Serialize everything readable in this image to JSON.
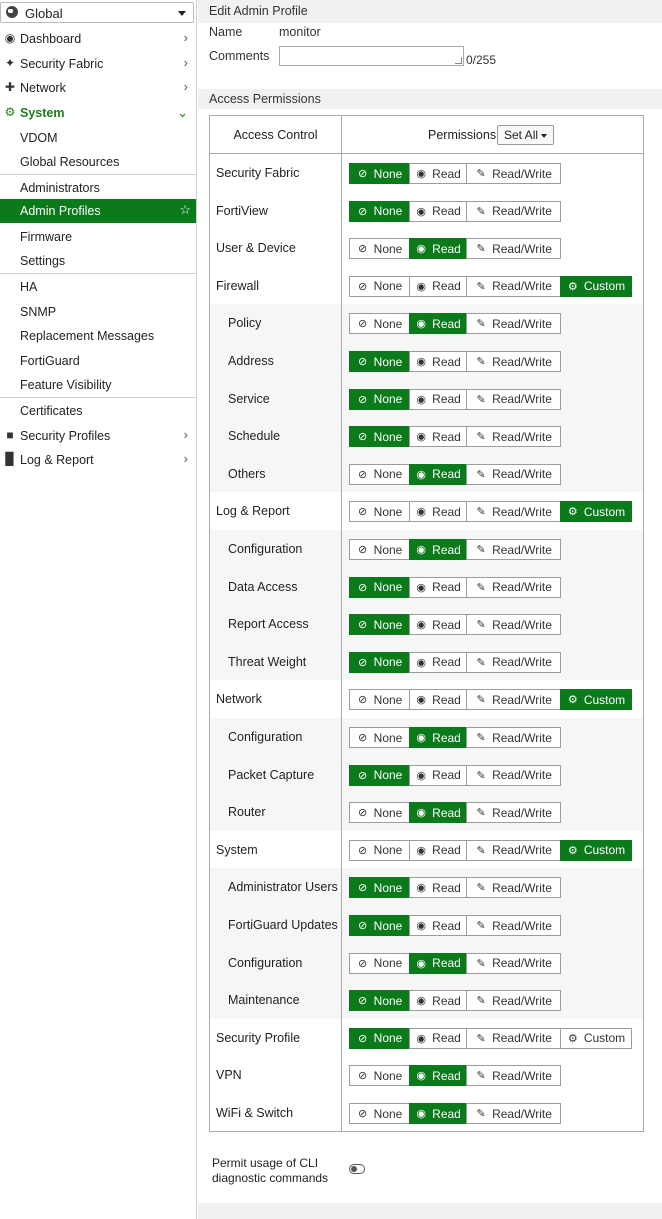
{
  "sidebar": {
    "vdom_select": "Global",
    "items": [
      {
        "label": "Dashboard",
        "icon": "dashboard-icon"
      },
      {
        "label": "Security Fabric",
        "icon": "security-fabric-icon"
      },
      {
        "label": "Network",
        "icon": "network-icon"
      },
      {
        "label": "System",
        "icon": "gear-icon"
      },
      {
        "label": "VDOM"
      },
      {
        "label": "Global Resources"
      },
      {
        "label": "Administrators"
      },
      {
        "label": "Admin Profiles"
      },
      {
        "label": "Firmware"
      },
      {
        "label": "Settings"
      },
      {
        "label": "HA"
      },
      {
        "label": "SNMP"
      },
      {
        "label": "Replacement Messages"
      },
      {
        "label": "FortiGuard"
      },
      {
        "label": "Feature Visibility"
      },
      {
        "label": "Certificates"
      },
      {
        "label": "Security Profiles",
        "icon": "lock-icon"
      },
      {
        "label": "Log & Report",
        "icon": "bar-chart-icon"
      }
    ]
  },
  "main": {
    "title": "Edit Admin Profile",
    "name_label": "Name",
    "name_value": "monitor",
    "comments_label": "Comments",
    "comments_value": "",
    "comments_counter": "0/255",
    "section_title": "Access Permissions",
    "table": {
      "col_access": "Access Control",
      "col_permissions": "Permissions",
      "set_all": "Set All",
      "button_labels": {
        "none": "None",
        "read": "Read",
        "rw": "Read/Write",
        "custom": "Custom"
      },
      "rows": [
        {
          "name": "Security Fabric",
          "child": false,
          "selected": "none",
          "custom": false
        },
        {
          "name": "FortiView",
          "child": false,
          "selected": "none",
          "custom": false
        },
        {
          "name": "User & Device",
          "child": false,
          "selected": "read",
          "custom": false
        },
        {
          "name": "Firewall",
          "child": false,
          "selected": "custom",
          "custom": true
        },
        {
          "name": "Policy",
          "child": true,
          "selected": "read",
          "custom": false
        },
        {
          "name": "Address",
          "child": true,
          "selected": "none",
          "custom": false
        },
        {
          "name": "Service",
          "child": true,
          "selected": "none",
          "custom": false
        },
        {
          "name": "Schedule",
          "child": true,
          "selected": "none",
          "custom": false
        },
        {
          "name": "Others",
          "child": true,
          "selected": "read",
          "custom": false
        },
        {
          "name": "Log & Report",
          "child": false,
          "selected": "custom",
          "custom": true
        },
        {
          "name": "Configuration",
          "child": true,
          "selected": "read",
          "custom": false
        },
        {
          "name": "Data Access",
          "child": true,
          "selected": "none",
          "custom": false
        },
        {
          "name": "Report Access",
          "child": true,
          "selected": "none",
          "custom": false
        },
        {
          "name": "Threat Weight",
          "child": true,
          "selected": "none",
          "custom": false
        },
        {
          "name": "Network",
          "child": false,
          "selected": "custom",
          "custom": true
        },
        {
          "name": "Configuration",
          "child": true,
          "selected": "read",
          "custom": false
        },
        {
          "name": "Packet Capture",
          "child": true,
          "selected": "none",
          "custom": false
        },
        {
          "name": "Router",
          "child": true,
          "selected": "read",
          "custom": false
        },
        {
          "name": "System",
          "child": false,
          "selected": "custom",
          "custom": true
        },
        {
          "name": "Administrator Users",
          "child": true,
          "selected": "none",
          "custom": false
        },
        {
          "name": "FortiGuard Updates",
          "child": true,
          "selected": "none",
          "custom": false
        },
        {
          "name": "Configuration",
          "child": true,
          "selected": "read",
          "custom": false
        },
        {
          "name": "Maintenance",
          "child": true,
          "selected": "none",
          "custom": false
        },
        {
          "name": "Security Profile",
          "child": false,
          "selected": "none",
          "custom": true
        },
        {
          "name": "VPN",
          "child": false,
          "selected": "read",
          "custom": false
        },
        {
          "name": "WiFi & Switch",
          "child": false,
          "selected": "read",
          "custom": false
        }
      ]
    },
    "cli_label": "Permit usage of CLI diagnostic commands",
    "cli_enabled": false,
    "colors": {
      "accent": "#0a7a1a",
      "section_bg": "#f1f1f1"
    }
  }
}
